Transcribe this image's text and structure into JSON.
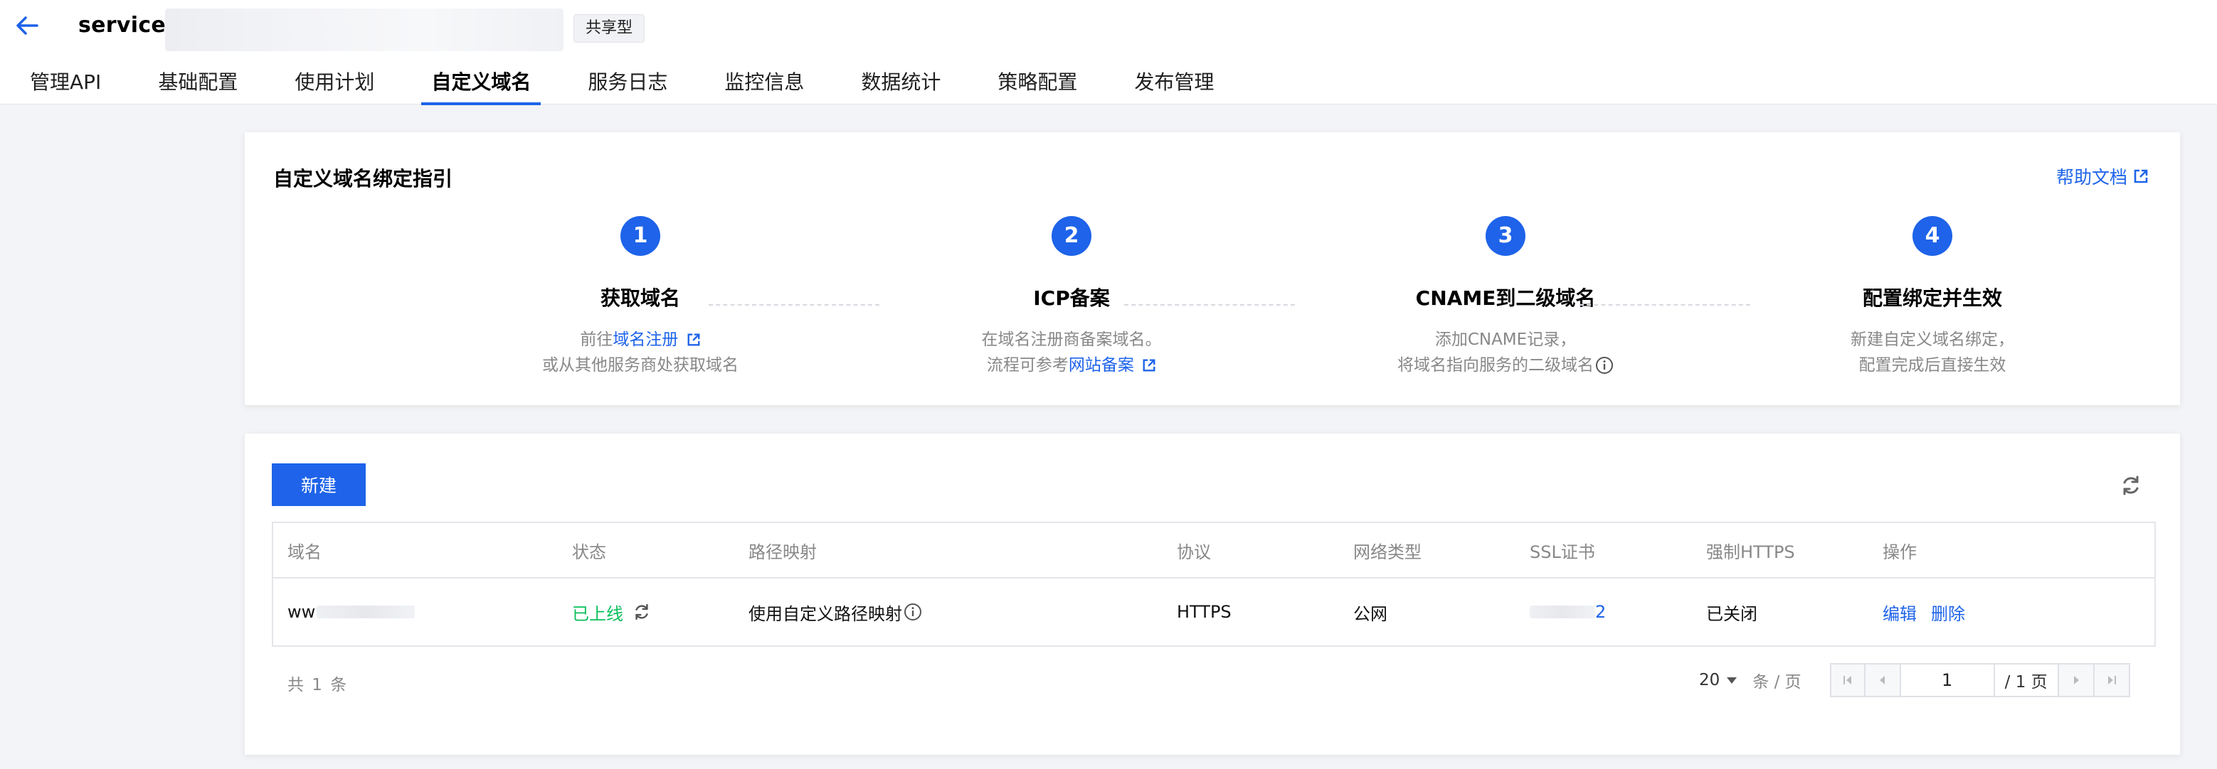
{
  "header": {
    "title_prefix": "service-",
    "type_tag": "共享型",
    "tabs": [
      {
        "label": "管理API"
      },
      {
        "label": "基础配置"
      },
      {
        "label": "使用计划"
      },
      {
        "label": "自定义域名",
        "active": true
      },
      {
        "label": "服务日志"
      },
      {
        "label": "监控信息"
      },
      {
        "label": "数据统计"
      },
      {
        "label": "策略配置"
      },
      {
        "label": "发布管理"
      }
    ]
  },
  "guide": {
    "title": "自定义域名绑定指引",
    "help_link": "帮助文档",
    "steps": [
      {
        "num": "1",
        "title": "获取域名",
        "line1_prefix": "前往",
        "line1_link": "域名注册",
        "line2": "或从其他服务商处获取域名"
      },
      {
        "num": "2",
        "title": "ICP备案",
        "line1": "在域名注册商备案域名。",
        "line2_prefix": "流程可参考",
        "line2_link": "网站备案"
      },
      {
        "num": "3",
        "title": "CNAME到二级域名",
        "line1": "添加CNAME记录，",
        "line2": "将域名指向服务的二级域名"
      },
      {
        "num": "4",
        "title": "配置绑定并生效",
        "line1": "新建自定义域名绑定，",
        "line2": "配置完成后直接生效"
      }
    ]
  },
  "list": {
    "new_button": "新建",
    "columns": [
      "域名",
      "状态",
      "路径映射",
      "协议",
      "网络类型",
      "SSL证书",
      "强制HTTPS",
      "操作"
    ],
    "rows": [
      {
        "domain": "ww",
        "status": "已上线",
        "path_mapping": "使用自定义路径映射",
        "protocol": "HTTPS",
        "network": "公网",
        "ssl": "2",
        "force_https": "已关闭",
        "op_edit": "编辑",
        "op_delete": "删除"
      }
    ],
    "total": "共 1 条",
    "pager": {
      "page_size": "20",
      "page_unit": "条 / 页",
      "current_page": "1",
      "total_pages": "/ 1 页"
    }
  },
  "colors": {
    "primary": "#1e63e9",
    "online": "#0abf5b",
    "muted": "#888888",
    "background": "#f3f4f7"
  }
}
